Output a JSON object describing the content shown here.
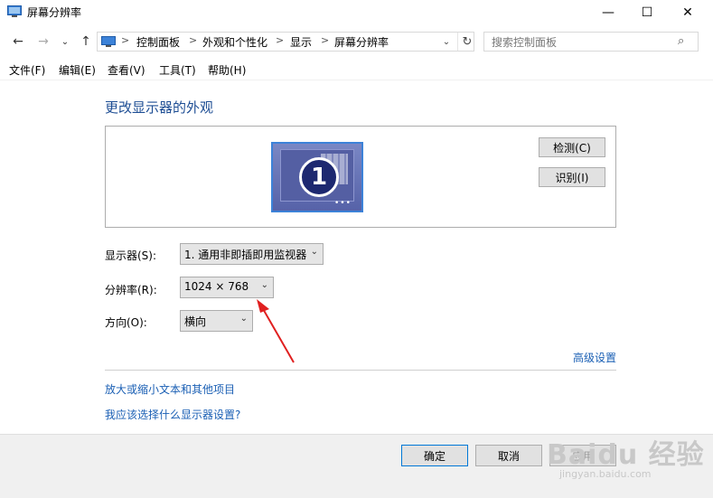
{
  "window": {
    "title": "屏幕分辨率",
    "minimize": "—",
    "maximize": "☐",
    "close": "✕"
  },
  "nav": {
    "back": "←",
    "forward": "→",
    "recent": "⌄",
    "up": "↑",
    "breadcrumbs": [
      "控制面板",
      "外观和个性化",
      "显示",
      "屏幕分辨率"
    ],
    "separator": ">",
    "dropdown": "⌄",
    "refresh": "↻",
    "search_placeholder": "搜索控制面板",
    "search_icon": "⌕"
  },
  "menu": {
    "items": [
      "文件(F)",
      "编辑(E)",
      "查看(V)",
      "工具(T)",
      "帮助(H)"
    ]
  },
  "content": {
    "title": "更改显示器的外观",
    "monitor_number": "1",
    "monitor_dots": "•••",
    "detect_button": "检测(C)",
    "identify_button": "识别(I)",
    "display_label": "显示器(S):",
    "display_value": "1. 通用非即插即用监视器",
    "resolution_label": "分辨率(R):",
    "resolution_value": "1024 × 768",
    "orientation_label": "方向(O):",
    "orientation_value": "横向",
    "combo_arrow": "⌄",
    "advanced_link": "高级设置",
    "text_size_link": "放大或缩小文本和其他项目",
    "which_settings_link": "我应该选择什么显示器设置?"
  },
  "footer": {
    "ok_button": "确定",
    "cancel_button": "取消",
    "apply_button": "应用"
  },
  "watermark": {
    "logo": "Baidu 经验",
    "url": "jingyan.baidu.com"
  },
  "colors": {
    "title_blue": "#1e4e94",
    "link_blue": "#1a5fb4",
    "annotation_red": "#e02020"
  }
}
